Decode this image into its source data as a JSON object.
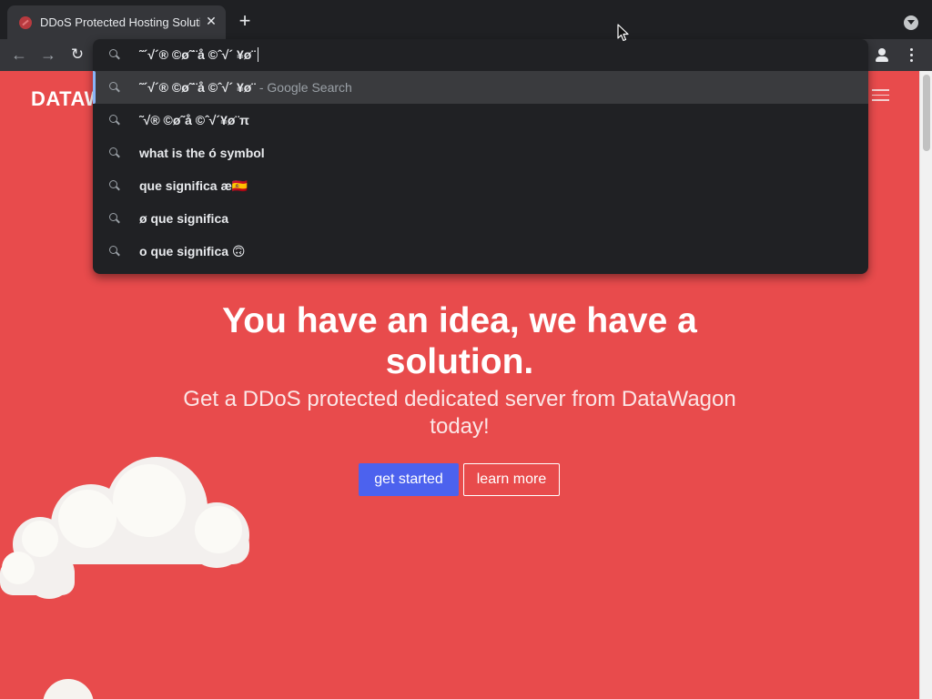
{
  "browser": {
    "tab_title": "DDoS Protected Hosting Solutio",
    "tab_close": "✕",
    "new_tab": "+",
    "back": "←",
    "forward": "→",
    "reload": "↻"
  },
  "omnibox": {
    "input": "˜´√´® ©ø˜¨å ©ˆ√´ ¥ø¨",
    "suggestions": [
      {
        "text": "˜´√´® ©ø˜¨å ©ˆ√´ ¥ø¨",
        "suffix": " - Google Search",
        "selected": true
      },
      {
        "text": "˜√® ©ø˜å ©ˆ√´¥ø¨π",
        "suffix": "",
        "selected": false
      },
      {
        "text": "what is the ó symbol",
        "suffix": "",
        "selected": false
      },
      {
        "text": "que significa æ🇪🇸",
        "suffix": "",
        "selected": false
      },
      {
        "text": "ø que significa",
        "suffix": "",
        "selected": false
      },
      {
        "text": "o que significa 🙃",
        "suffix": "",
        "selected": false
      }
    ]
  },
  "page": {
    "brand": "DATAW",
    "hero_title": "You have an idea, we have a solution.",
    "hero_subtitle": "Get a DDoS protected dedicated server from DataWagon today!",
    "get_started": "get started",
    "learn_more": "learn more"
  },
  "colors": {
    "page_background": "#e84b4c",
    "primary_button": "#4c62ee",
    "omnibox_background": "#202124"
  }
}
